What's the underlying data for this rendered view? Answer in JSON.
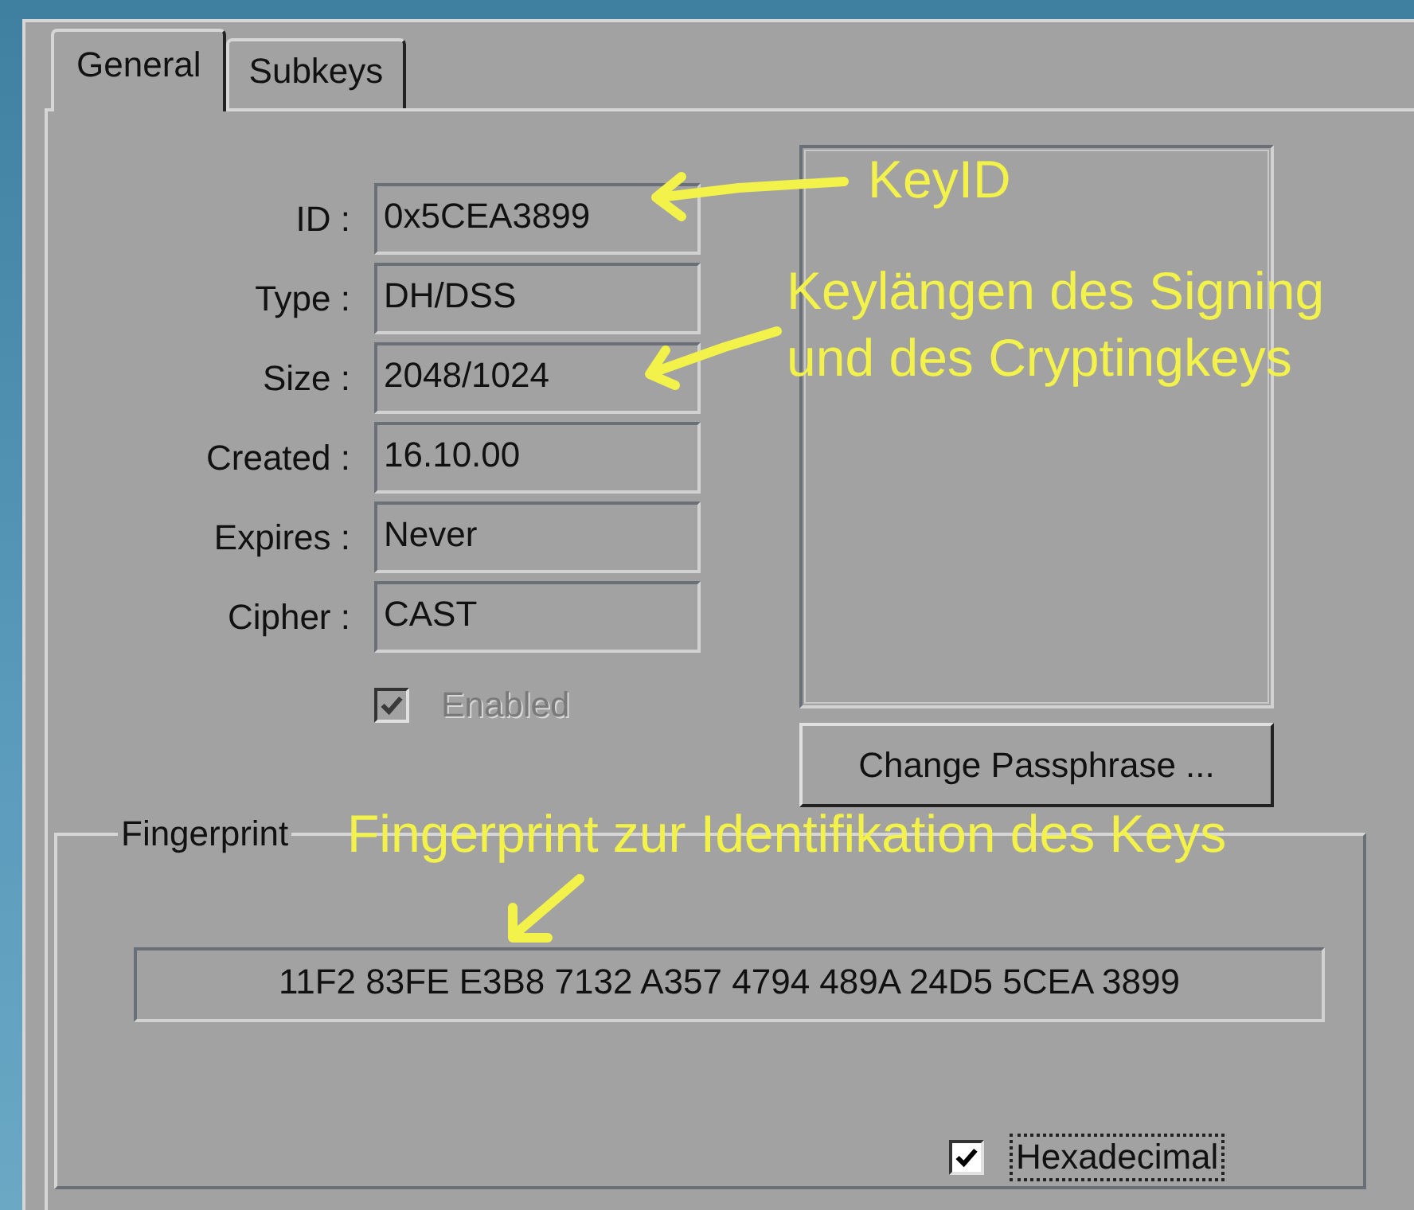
{
  "tabs": [
    {
      "label": "General",
      "selected": true
    },
    {
      "label": "Subkeys",
      "selected": false
    }
  ],
  "fields": [
    {
      "label": "ID :",
      "value": "0x5CEA3899"
    },
    {
      "label": "Type :",
      "value": "DH/DSS"
    },
    {
      "label": "Size :",
      "value": "2048/1024"
    },
    {
      "label": "Created :",
      "value": "16.10.00"
    },
    {
      "label": "Expires :",
      "value": "Never"
    },
    {
      "label": "Cipher :",
      "value": "CAST"
    }
  ],
  "enabled": {
    "label": "Enabled",
    "checked": true,
    "disabled": true
  },
  "change_passphrase_button": "Change Passphrase ...",
  "fingerprint": {
    "legend": "Fingerprint",
    "value": "11F2 83FE E3B8 7132 A357  4794 489A 24D5 5CEA 3899",
    "hexadecimal": {
      "label": "Hexadecimal",
      "checked": true,
      "disabled": false,
      "focused": true
    }
  },
  "annotations": [
    {
      "lines": [
        "KeyID"
      ]
    },
    {
      "lines": [
        "Keylängen des Signing",
        "und des Cryptingkeys"
      ]
    },
    {
      "lines": [
        "Fingerprint zur Identifikation des Keys"
      ]
    }
  ]
}
